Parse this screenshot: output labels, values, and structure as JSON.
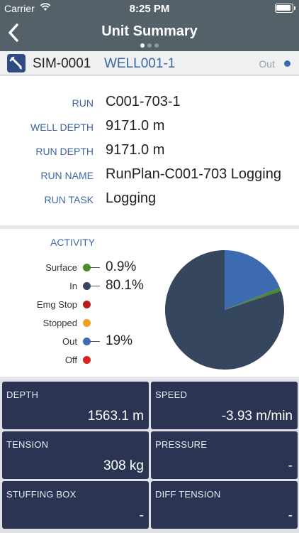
{
  "status_bar": {
    "carrier": "Carrier",
    "time": "8:25 PM"
  },
  "header": {
    "title": "Unit Summary",
    "page_count": 3,
    "current_page": 1
  },
  "unit": {
    "id": "SIM-0001",
    "well": "WELL001-1",
    "status": "Out",
    "status_color": "#3d6bb0"
  },
  "info": [
    {
      "label": "RUN",
      "value": "C001-703-1"
    },
    {
      "label": "WELL DEPTH",
      "value": "9171.0 m"
    },
    {
      "label": "RUN DEPTH",
      "value": "9171.0 m"
    },
    {
      "label": "RUN NAME",
      "value": "RunPlan-C001-703 Logging"
    },
    {
      "label": "RUN TASK",
      "value": "Logging"
    }
  ],
  "activity": {
    "title": "ACTIVITY",
    "legend": [
      {
        "label": "Surface",
        "color": "#4d8a2e",
        "pct": "0.9%"
      },
      {
        "label": "In",
        "color": "#36465f",
        "pct": "80.1%"
      },
      {
        "label": "Emg Stop",
        "color": "#b71c1c",
        "pct": ""
      },
      {
        "label": "Stopped",
        "color": "#f0a020",
        "pct": ""
      },
      {
        "label": "Out",
        "color": "#3d6bb0",
        "pct": "19%"
      },
      {
        "label": "Off",
        "color": "#d92020",
        "pct": ""
      }
    ]
  },
  "chart_data": {
    "type": "pie",
    "categories": [
      "Surface",
      "In",
      "Emg Stop",
      "Stopped",
      "Out",
      "Off"
    ],
    "values": [
      0.9,
      80.1,
      0,
      0,
      19,
      0
    ],
    "colors": [
      "#4d8a2e",
      "#36465f",
      "#b71c1c",
      "#f0a020",
      "#3d6bb0",
      "#d92020"
    ],
    "title": "ACTIVITY"
  },
  "tiles": [
    {
      "label": "DEPTH",
      "value": "1563.1 m"
    },
    {
      "label": "SPEED",
      "value": "-3.93 m/min"
    },
    {
      "label": "TENSION",
      "value": "308 kg"
    },
    {
      "label": "PRESSURE",
      "value": "-"
    },
    {
      "label": "STUFFING BOX",
      "value": "-"
    },
    {
      "label": "DIFF TENSION",
      "value": "-"
    }
  ]
}
